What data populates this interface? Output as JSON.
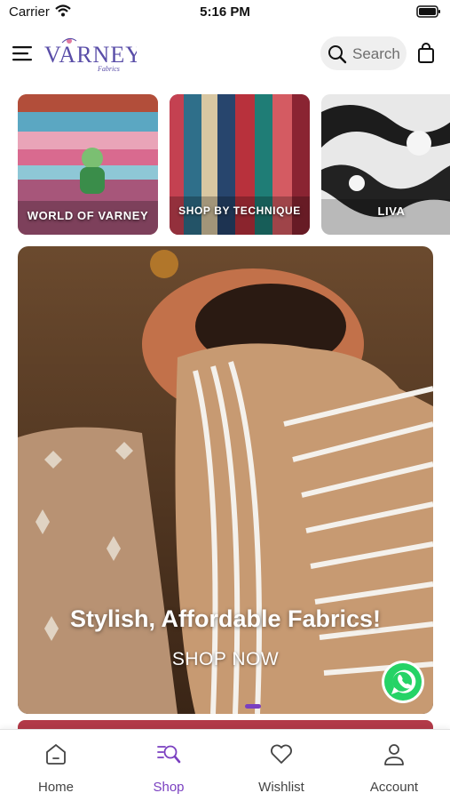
{
  "status_bar": {
    "carrier": "Carrier",
    "time": "5:16 PM"
  },
  "header": {
    "logo": {
      "brand": "VARNEY",
      "sub": "Fabrics"
    },
    "search_label": "Search"
  },
  "categories": [
    {
      "label": "WORLD OF VARNEY"
    },
    {
      "label": "SHOP BY TECHNIQUE"
    },
    {
      "label": "LIVA"
    }
  ],
  "hero": {
    "title": "Stylish, Affordable Fabrics!",
    "cta": "SHOP NOW"
  },
  "tabs": [
    {
      "label": "Home",
      "icon": "home-icon"
    },
    {
      "label": "Shop",
      "icon": "shop-search-icon",
      "active": true
    },
    {
      "label": "Wishlist",
      "icon": "heart-icon"
    },
    {
      "label": "Account",
      "icon": "account-icon"
    }
  ],
  "colors": {
    "accent": "#7a3fc0",
    "whatsapp": "#25d366"
  }
}
